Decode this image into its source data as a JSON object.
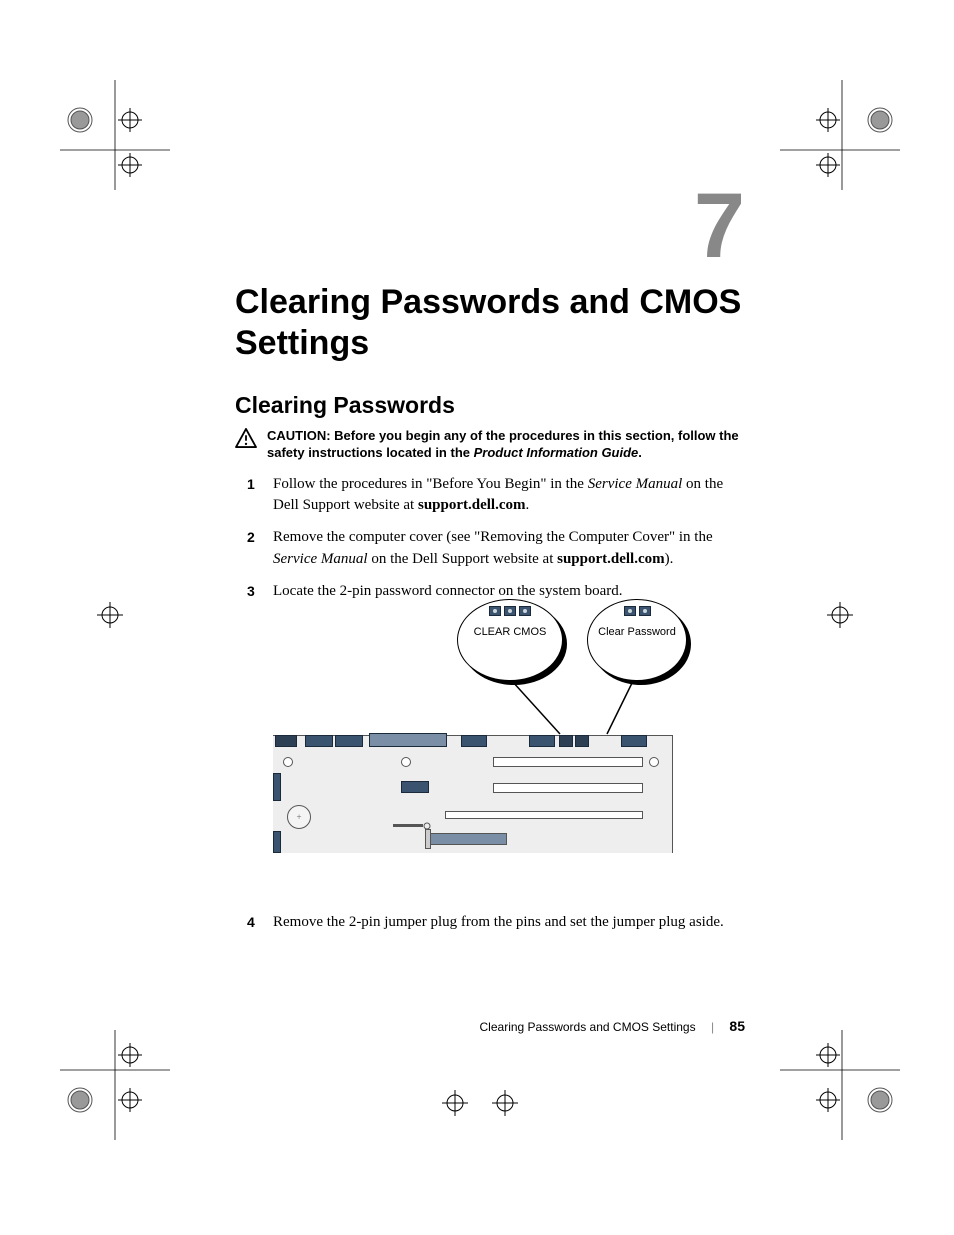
{
  "chapter": {
    "number": "7",
    "title": "Clearing Passwords and CMOS Settings"
  },
  "section": {
    "title": "Clearing Passwords"
  },
  "caution": {
    "label": "CAUTION:",
    "body_a": " Before you begin any of the procedures in this section, follow the safety instructions located in the ",
    "body_b": "Product Information Guide",
    "body_c": "."
  },
  "steps": {
    "s1_a": "Follow the procedures in \"Before You Begin\" in the ",
    "s1_b": "Service Manual",
    "s1_c": " on the Dell Support website at ",
    "s1_d": "support.dell.com",
    "s1_e": ".",
    "s2_a": "Remove the computer cover (see \"Removing the Computer Cover\" in the ",
    "s2_b": "Service Manual",
    "s2_c": " on the Dell Support website at ",
    "s2_d": "support.dell.com",
    "s2_e": ").",
    "s3": "Locate the 2-pin password connector on the system board.",
    "s4": "Remove the 2-pin jumper plug from the pins and set the jumper plug aside."
  },
  "diagram": {
    "callout_left": "CLEAR CMOS",
    "callout_right": "Clear Password"
  },
  "footer": {
    "title": "Clearing Passwords and CMOS Settings",
    "page": "85"
  }
}
